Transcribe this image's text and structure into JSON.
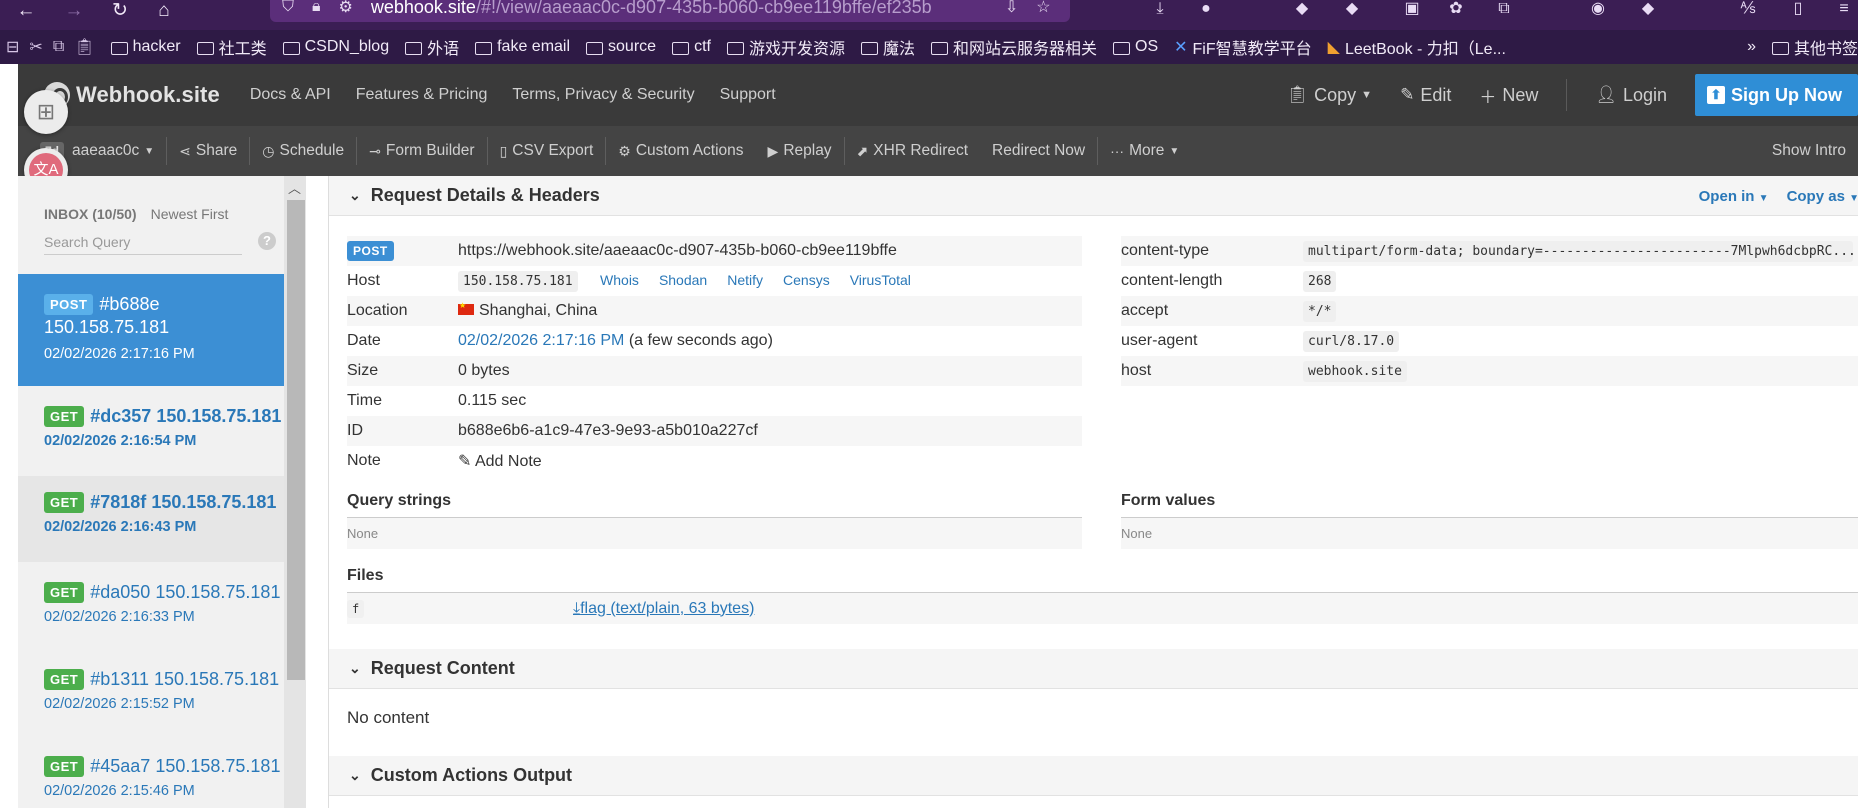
{
  "browser": {
    "url_host": "webhook.site",
    "url_rest": "/#!/view/aaeaac0c-d907-435b-b060-cb9ee119bffe/ef235b",
    "bookmarks": [
      "hacker",
      "社工类",
      "CSDN_blog",
      "外语",
      "fake email",
      "source",
      "ctf",
      "游戏开发资源",
      "魔法",
      "和网站云服务器相关",
      "OS",
      "FiF智慧教学平台",
      "LeetBook - 力扣（Le...",
      "其他书签"
    ]
  },
  "header": {
    "logo": "Webhook.site",
    "nav": [
      "Docs & API",
      "Features & Pricing",
      "Terms, Privacy & Security",
      "Support"
    ],
    "copy": "Copy",
    "edit": "Edit",
    "new": "New",
    "login": "Login",
    "signup": "Sign Up Now"
  },
  "toolbar": {
    "badge": "7d",
    "token": "aaeaac0c",
    "items": [
      "Share",
      "Schedule",
      "Form Builder",
      "CSV Export",
      "Custom Actions",
      "Replay",
      "XHR Redirect",
      "Redirect Now",
      "More"
    ],
    "show_intro": "Show Intro"
  },
  "sidebar": {
    "inbox": "INBOX (10/50)",
    "sort": "Newest First",
    "search_placeholder": "Search Query",
    "requests": [
      {
        "method": "POST",
        "id": "#b688e",
        "ip": "150.158.75.181",
        "date": "02/02/2026 2:17:16 PM"
      },
      {
        "method": "GET",
        "id": "#dc357",
        "ip": "150.158.75.181",
        "date": "02/02/2026 2:16:54 PM"
      },
      {
        "method": "GET",
        "id": "#7818f",
        "ip": "150.158.75.181",
        "date": "02/02/2026 2:16:43 PM"
      },
      {
        "method": "GET",
        "id": "#da050",
        "ip": "150.158.75.181",
        "date": "02/02/2026 2:16:33 PM"
      },
      {
        "method": "GET",
        "id": "#b1311",
        "ip": "150.158.75.181",
        "date": "02/02/2026 2:15:52 PM"
      },
      {
        "method": "GET",
        "id": "#45aa7",
        "ip": "150.158.75.181",
        "date": "02/02/2026 2:15:46 PM"
      }
    ]
  },
  "details": {
    "title": "Request Details & Headers",
    "open_in": "Open in",
    "copy_as": "Copy as",
    "method_badge": "POST",
    "url": "https://webhook.site/aaeaac0c-d907-435b-b060-cb9ee119bffe",
    "host_label": "Host",
    "host": "150.158.75.181",
    "host_links": [
      "Whois",
      "Shodan",
      "Netify",
      "Censys",
      "VirusTotal"
    ],
    "location_label": "Location",
    "location": "Shanghai, China",
    "date_label": "Date",
    "date": "02/02/2026 2:17:16 PM",
    "date_rel": "(a few seconds ago)",
    "size_label": "Size",
    "size": "0 bytes",
    "time_label": "Time",
    "time": "0.115 sec",
    "id_label": "ID",
    "id": "b688e6b6-a1c9-47e3-9e93-a5b010a227cf",
    "note_label": "Note",
    "add_note": "Add Note",
    "headers": [
      {
        "k": "content-type",
        "v": "multipart/form-data; boundary=------------------------7Mlpwh6dcbpRC..."
      },
      {
        "k": "content-length",
        "v": "268"
      },
      {
        "k": "accept",
        "v": "*/*"
      },
      {
        "k": "user-agent",
        "v": "curl/8.17.0"
      },
      {
        "k": "host",
        "v": "webhook.site"
      }
    ],
    "query_strings": "Query strings",
    "query_none": "None",
    "form_values": "Form values",
    "form_none": "None",
    "files": "Files",
    "file_field": "f",
    "file_link": "flag (text/plain, 63 bytes)"
  },
  "content": {
    "title": "Request Content",
    "body": "No content"
  },
  "custom_actions": {
    "title": "Custom Actions Output"
  }
}
